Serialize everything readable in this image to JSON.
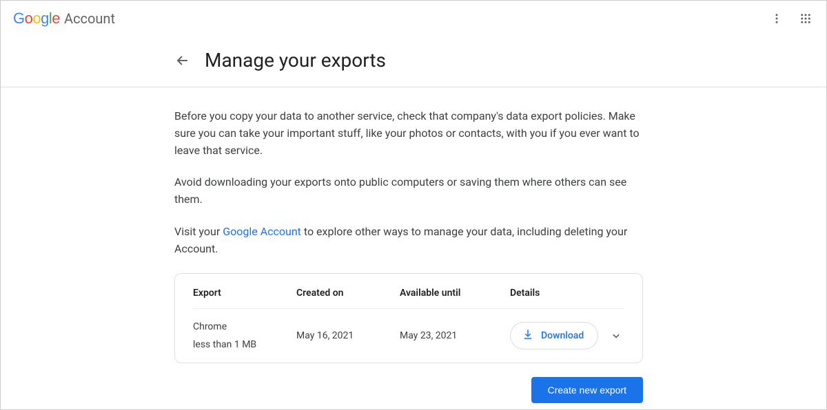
{
  "header": {
    "brand_sub": "Account"
  },
  "page_title": "Manage your exports",
  "intro": {
    "p1": "Before you copy your data to another service, check that company's data export policies. Make sure you can take your important stuff, like your photos or contacts, with you if you ever want to leave that service.",
    "p2": "Avoid downloading your exports onto public computers or saving them where others can see them.",
    "p3a": "Visit your ",
    "p3_link": "Google Account",
    "p3b": " to explore other ways to manage your data, including deleting your Account."
  },
  "table": {
    "headers": {
      "export": "Export",
      "created": "Created on",
      "available": "Available until",
      "details": "Details"
    },
    "row": {
      "name": "Chrome",
      "size": "less than 1 MB",
      "created": "May 16, 2021",
      "available": "May 23, 2021",
      "download_label": "Download"
    }
  },
  "primary_action": "Create new export"
}
